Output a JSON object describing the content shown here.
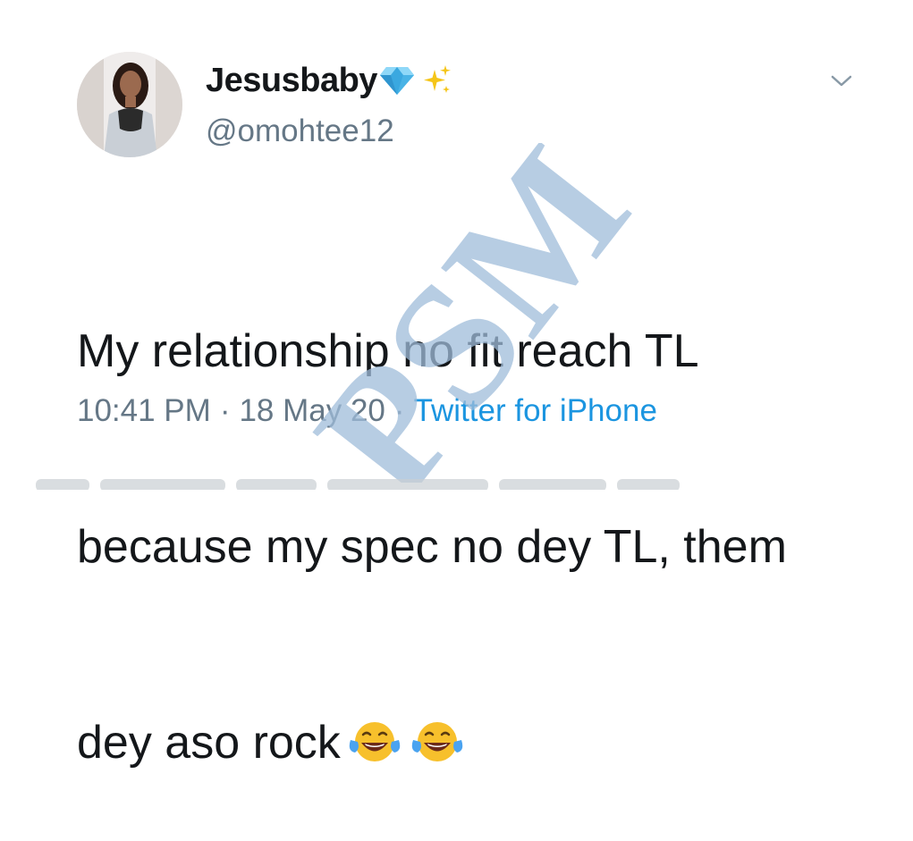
{
  "tweet": {
    "display_name": "Jesusbaby",
    "name_emojis": [
      "gem-stone-emoji",
      "sparkles-emoji"
    ],
    "handle": "@omohtee12",
    "text_lines": [
      "My relationship no fit reach TL",
      "because my spec no dey TL, them",
      "dey aso rock"
    ],
    "text_emojis": [
      "face-with-tears-of-joy-emoji",
      "face-with-tears-of-joy-emoji"
    ],
    "time": "10:41 PM",
    "date": "18 May 20",
    "separator": "·",
    "source": "Twitter for iPhone"
  },
  "watermark": {
    "text": "PSM"
  },
  "colors": {
    "text_primary": "#14171a",
    "text_secondary": "#657786",
    "link": "#1b95e0",
    "watermark": "#9fbcd9"
  }
}
